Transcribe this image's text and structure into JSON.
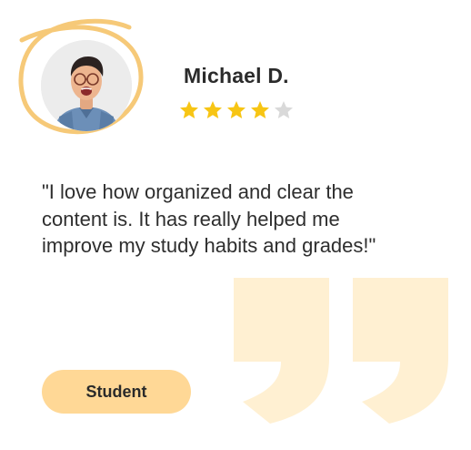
{
  "reviewer": {
    "name": "Michael D.",
    "rating": 4,
    "max_rating": 5,
    "avatar_icon": "person-photo-avatar"
  },
  "testimonial": {
    "text": "\"I love how organized and clear the content is. It has really helped me improve my study habits and grades!\""
  },
  "badge": {
    "label": "Student"
  },
  "colors": {
    "accent": "#ffd896",
    "ring": "#f6c978",
    "quote_mark": "#fff0d2",
    "star_filled": "#f7c514",
    "star_empty": "#d9d9d9",
    "text": "#2e2e2e"
  }
}
